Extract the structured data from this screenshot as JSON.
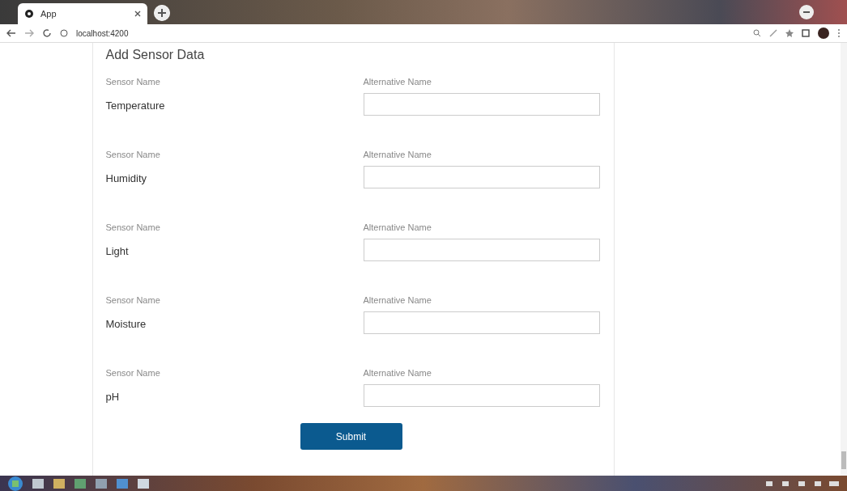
{
  "browser": {
    "tab_title": "App",
    "address": "localhost:4200"
  },
  "form": {
    "title": "Add Sensor Data",
    "rows": [
      {
        "label": "Sensor Name",
        "value": "Temperature",
        "alt_label": "Alternative Name",
        "alt_value": ""
      },
      {
        "label": "Sensor Name",
        "value": "Humidity",
        "alt_label": "Alternative Name",
        "alt_value": ""
      },
      {
        "label": "Sensor Name",
        "value": "Light",
        "alt_label": "Alternative Name",
        "alt_value": ""
      },
      {
        "label": "Sensor Name",
        "value": "Moisture",
        "alt_label": "Alternative Name",
        "alt_value": ""
      },
      {
        "label": "Sensor Name",
        "value": "pH",
        "alt_label": "Alternative Name",
        "alt_value": ""
      }
    ],
    "submit": "Submit"
  }
}
